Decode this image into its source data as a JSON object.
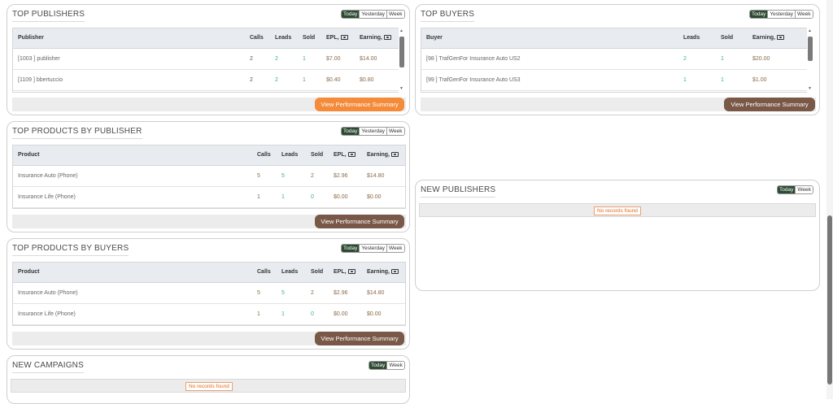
{
  "segments": [
    "Today",
    "Yesterday",
    "Week"
  ],
  "segments_short": [
    "Today",
    "Week"
  ],
  "view_summary": "View Performance Summary",
  "no_records": "No records found",
  "top_publishers": {
    "title": "TOP PUBLISHERS",
    "headers": {
      "name": "Publisher",
      "calls": "Calls",
      "leads": "Leads",
      "sold": "Sold",
      "epl": "EPL,",
      "earning": "Earning,"
    },
    "rows": [
      {
        "name": "[1003 ] publisher",
        "calls": "2",
        "leads": "2",
        "sold": "1",
        "epl": "$7.00",
        "earning": "$14.00"
      },
      {
        "name": "[1109 ] bbertuccio",
        "calls": "2",
        "leads": "2",
        "sold": "1",
        "epl": "$0.40",
        "earning": "$0.80"
      }
    ]
  },
  "top_buyers": {
    "title": "TOP BUYERS",
    "headers": {
      "name": "Buyer",
      "leads": "Leads",
      "sold": "Sold",
      "earning": "Earning,"
    },
    "rows": [
      {
        "name": "[98 ] TrafGenFor Insurance Auto US2",
        "leads": "2",
        "sold": "1",
        "earning": "$20.00"
      },
      {
        "name": "[99 ] TrafGenFor Insurance Auto US3",
        "leads": "1",
        "sold": "1",
        "earning": "$1.00"
      }
    ]
  },
  "products_by_publisher": {
    "title": "TOP PRODUCTS BY PUBLISHER",
    "headers": {
      "name": "Product",
      "calls": "Calls",
      "leads": "Leads",
      "sold": "Sold",
      "epl": "EPL,",
      "earning": "Earning,"
    },
    "rows": [
      {
        "name": "Insurance Auto (Phone)",
        "calls": "5",
        "leads": "5",
        "sold": "2",
        "epl": "$2.96",
        "earning": "$14.80"
      },
      {
        "name": "Insurance Life (Phone)",
        "calls": "1",
        "leads": "1",
        "sold": "0",
        "epl": "$0.00",
        "earning": "$0.00"
      }
    ]
  },
  "products_by_buyers": {
    "title": "TOP PRODUCTS BY BUYERS",
    "headers": {
      "name": "Product",
      "calls": "Calls",
      "leads": "Leads",
      "sold": "Sold",
      "epl": "EPL,",
      "earning": "Earning,"
    },
    "rows": [
      {
        "name": "Insurance Auto (Phone)",
        "calls": "5",
        "leads": "5",
        "sold": "2",
        "epl": "$2.96",
        "earning": "$14.80"
      },
      {
        "name": "Insurance Life (Phone)",
        "calls": "1",
        "leads": "1",
        "sold": "0",
        "epl": "$0.00",
        "earning": "$0.00"
      }
    ]
  },
  "new_publishers": {
    "title": "NEW PUBLISHERS"
  },
  "new_campaigns": {
    "title": "NEW CAMPAIGNS"
  },
  "colors": {
    "accent_dark": "#2d4a32",
    "button_brown": "#7a5848",
    "button_orange": "#f48b3b",
    "leads_green": "#3bb08a"
  }
}
